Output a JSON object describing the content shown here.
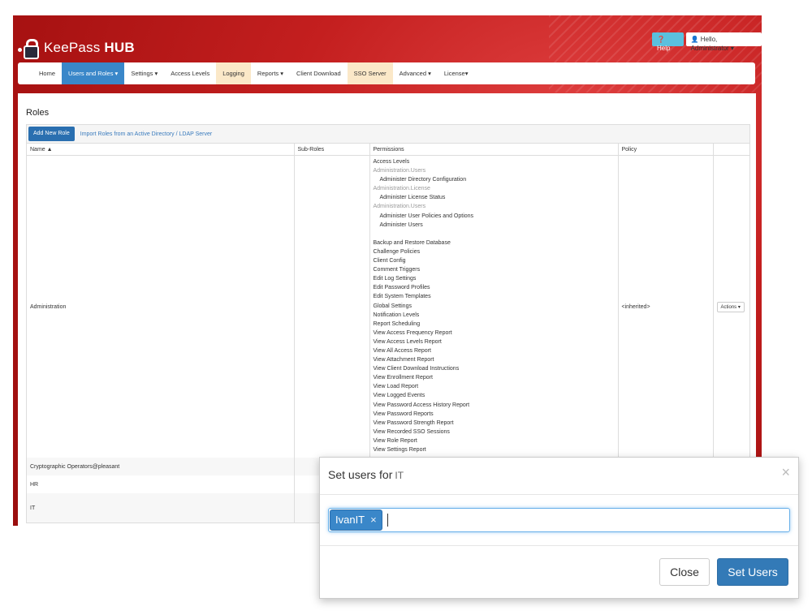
{
  "app": {
    "brand_light": "KeePass ",
    "brand_bold": "HUB"
  },
  "topbar": {
    "help_label": "Help",
    "user_label": "Hello, Administrator"
  },
  "nav": [
    {
      "label": "Home"
    },
    {
      "label": "Users and Roles ▾"
    },
    {
      "label": "Settings ▾"
    },
    {
      "label": "Access Levels"
    },
    {
      "label": "Logging"
    },
    {
      "label": "Reports ▾"
    },
    {
      "label": "Client Download"
    },
    {
      "label": "SSO Server"
    },
    {
      "label": "Advanced ▾"
    },
    {
      "label": "License▾"
    }
  ],
  "page": {
    "title": "Roles"
  },
  "toolbar": {
    "add_role": "Add New Role",
    "import_link": "Import Roles from an Active Directory / LDAP Server"
  },
  "table": {
    "headers": [
      "Name ▲",
      "Sub-Roles",
      "Permissions",
      "Policy",
      ""
    ],
    "admin_row": {
      "name": "Administration",
      "policy": "<inherited>",
      "actions": "Actions ▾",
      "permissions": [
        "Access Levels",
        "Administration.Users",
        "Administer Directory Configuration",
        "Administration.License",
        "Administer License Status",
        "Administration.Users",
        "Administer User Policies and Options",
        "Administer Users",
        "",
        "Backup and Restore Database",
        "Challenge Policies",
        "Client Config",
        "Comment Triggers",
        "Edit Log Settings",
        "Edit Password Profiles",
        "Edit System Templates",
        "Global Settings",
        "Notification Levels",
        "Report Scheduling",
        "View Access Frequency Report",
        "View Access Levels Report",
        "View All Access Report",
        "View Attachment Report",
        "View Client Download Instructions",
        "View Enrollment Report",
        "View Load Report",
        "View Logged Events",
        "View Password Access History Report",
        "View Password Reports",
        "View Password Strength Report",
        "View Recorded SSO Sessions",
        "View Role Report",
        "View Settings Report"
      ]
    },
    "other_rows": [
      {
        "name": "Cryptographic Operators@pleasant"
      },
      {
        "name": "HR"
      },
      {
        "name": "IT"
      }
    ]
  },
  "modal": {
    "title": "Set users for",
    "role": "IT",
    "close_x": "×",
    "tag": "IvanIT",
    "tag_remove": "×",
    "close_button": "Close",
    "submit_button": "Set Users"
  }
}
